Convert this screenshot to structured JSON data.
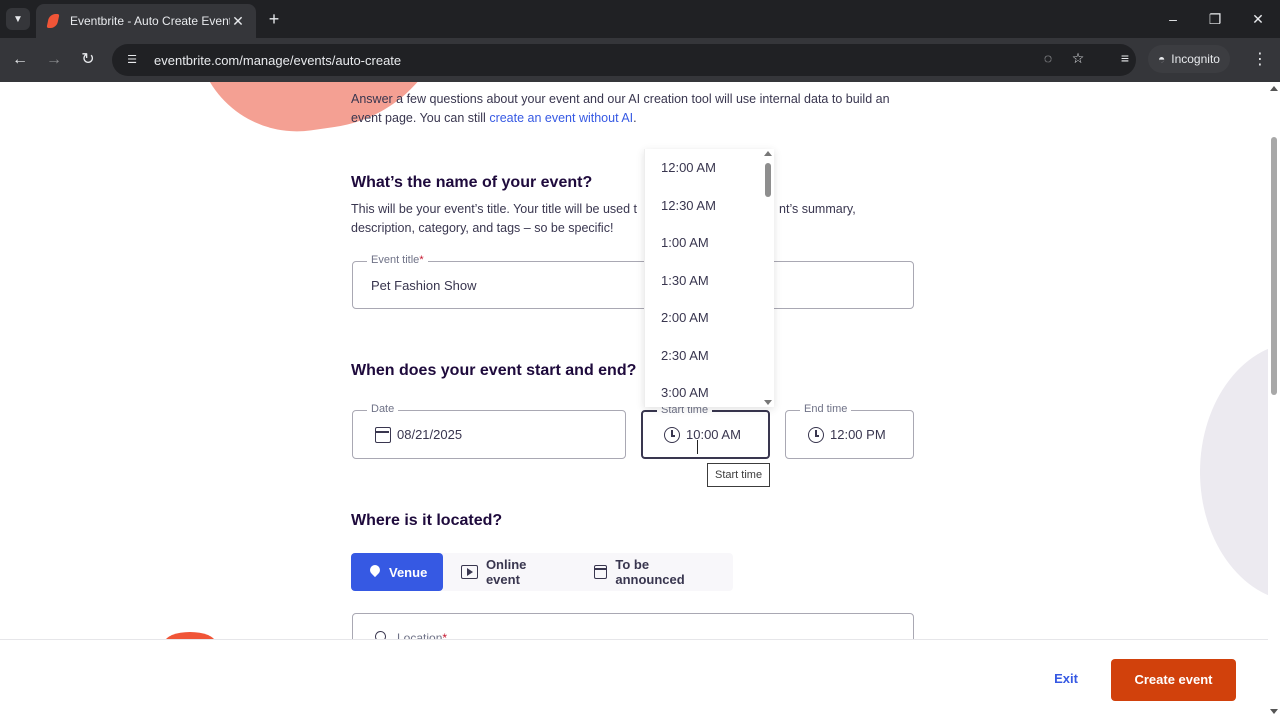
{
  "browser": {
    "tab_title": "Eventbrite - Auto Create Event",
    "url": "eventbrite.com/manage/events/auto-create",
    "incognito_label": "Incognito"
  },
  "intro": {
    "text": "Answer a few questions about your event and our AI creation tool will use internal data to build an event page. You can still ",
    "link": "create an event without AI",
    "suffix": "."
  },
  "name_section": {
    "heading": "What’s the name of your event?",
    "helper_start": "This will be your event’s title. Your title will be used t",
    "helper_end": "nt’s summary,",
    "helper_line2": "description, category, and tags – so be specific!",
    "field_label": "Event title",
    "required_mark": "*",
    "value": "Pet Fashion Show"
  },
  "when_section": {
    "heading": "When does your event start and end?",
    "date_label": "Date",
    "date_value": "08/21/2025",
    "start_label": "Start time",
    "start_value": "10:00 AM",
    "end_label": "End time",
    "end_value": "12:00 PM",
    "tooltip": "Start time"
  },
  "time_dropdown": {
    "options": [
      "12:00 AM",
      "12:30 AM",
      "1:00 AM",
      "1:30 AM",
      "2:00 AM",
      "2:30 AM",
      "3:00 AM"
    ]
  },
  "location_section": {
    "heading": "Where is it located?",
    "options": [
      "Venue",
      "Online event",
      "To be announced"
    ],
    "active": "Venue",
    "location_label": "Location",
    "required_mark": "*"
  },
  "footer": {
    "exit_label": "Exit",
    "create_label": "Create event"
  },
  "colors": {
    "accent_blue": "#3659e3",
    "create_orange": "#d1410c",
    "brand_coral": "#f05537"
  }
}
